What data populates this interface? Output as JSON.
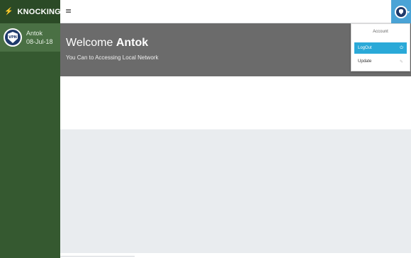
{
  "sidebar": {
    "brand": "KNOCKING",
    "brand_icon": "bolt-icon",
    "user": {
      "name": "Antok",
      "date": "08-Jul-18",
      "avatar": "vpn-shield-avatar",
      "avatar_text": "VPN"
    }
  },
  "topbar": {
    "menu_icon": "hamburger-icon",
    "user_avatar": "vpn-shield-avatar"
  },
  "welcome": {
    "greeting": "Welcome",
    "name": "Antok",
    "subtitle": "You Can to Accessing Local Network"
  },
  "dropdown": {
    "header": "Account",
    "items": [
      {
        "label": "LogOut",
        "icon": "power-icon",
        "active": true
      },
      {
        "label": "Update",
        "icon": "pencil-icon",
        "active": false
      }
    ]
  },
  "colors": {
    "sidebar": "#355930",
    "brand_bg": "#2b4a26",
    "user_panel": "#4a7044",
    "welcome_bg": "#6b6b6b",
    "accent": "#2aa9d8",
    "content_grey": "#e9ecef"
  }
}
